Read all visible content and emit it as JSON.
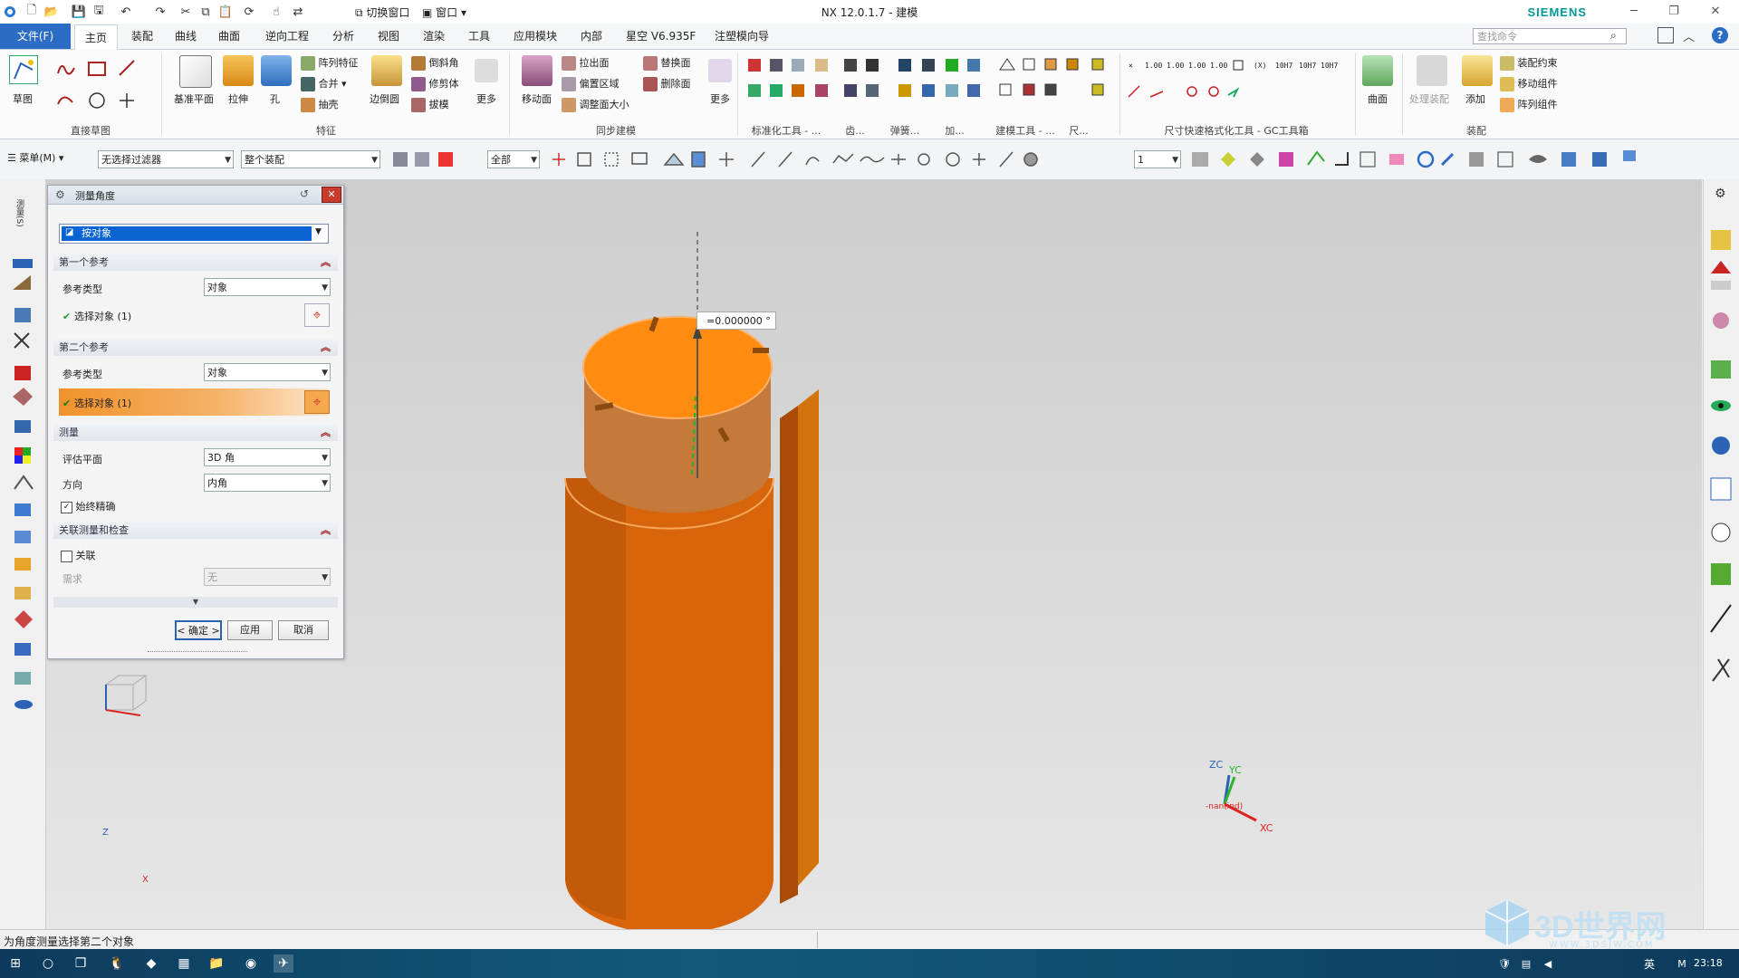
{
  "window": {
    "title": "NX 12.0.1.7 - 建模",
    "brand": "SIEMENS",
    "quick_access": [
      "切换窗口",
      "窗口"
    ]
  },
  "tabs": [
    "文件(F)",
    "主页",
    "装配",
    "曲线",
    "曲面",
    "逆向工程",
    "分析",
    "视图",
    "渲染",
    "工具",
    "应用模块",
    "内部",
    "星空 V6.935F",
    "注塑模向导"
  ],
  "search": {
    "placeholder": "查找命令"
  },
  "ribbon": {
    "groups": [
      "直接草图",
      "特征",
      "同步建模",
      "标准化工具 - ...",
      "齿...",
      "弹簧...",
      "加...",
      "建模工具 - ...",
      "尺...",
      "尺寸快速格式化工具 - GC工具箱",
      "装配"
    ],
    "sketch_label": "草图",
    "datum_label": "基准平面",
    "extrude_label": "拉伸",
    "hole_label": "孔",
    "feature_items": [
      "阵列特征",
      "合并",
      "抽壳"
    ],
    "edge_blend_label": "边倒圆",
    "edge_items": [
      "倒斜角",
      "修剪体",
      "拔模"
    ],
    "more_label": "更多",
    "move_face_label": "移动面",
    "sync_items": [
      "拉出面",
      "偏置区域",
      "调整面大小"
    ],
    "replace_items": [
      "替换面",
      "删除面"
    ],
    "more2_label": "更多",
    "surface_label": "曲面",
    "process_asm_label": "处理装配",
    "add_label": "添加",
    "asm_items": [
      "装配约束",
      "移动组件",
      "阵列组件"
    ]
  },
  "toolbar": {
    "menu_label": "菜单(M)",
    "filter_value": "无选择过滤器",
    "scope_value": "整个装配",
    "all_value": "全部",
    "layer_value": "1"
  },
  "dialog": {
    "title": "测量角度",
    "type_value": "按对象",
    "sec1": "第一个参考",
    "ref_type_label": "参考类型",
    "ref_type_value1": "对象",
    "select1": "选择对象 (1)",
    "sec2": "第二个参考",
    "ref_type_value2": "对象",
    "select2": "选择对象 (1)",
    "sec3": "测量",
    "eval_plane_label": "评估平面",
    "eval_plane_value": "3D 角",
    "direction_label": "方向",
    "direction_value": "内角",
    "always_precise": "始终精确",
    "sec4": "关联测量和检查",
    "assoc_label": "关联",
    "need_label": "需求",
    "need_value": "无",
    "ok": "< 确定 >",
    "apply": "应用",
    "cancel": "取消"
  },
  "viewport": {
    "angle_readout": "=0.000000 °",
    "triad": {
      "zc": "ZC",
      "yc": "YC",
      "xc": "XC",
      "origin": "-nan(ind)"
    },
    "csys": {
      "z": "Z",
      "x": "X"
    },
    "part_color": "#e56f0c",
    "top_face_color": "#ff8c10"
  },
  "status": {
    "prompt": "为角度测量选择第二个对象"
  },
  "watermark": {
    "title": "3D世界网",
    "url": "WWW.3DSJW.COM"
  },
  "taskbar": {
    "ime": "英",
    "clock": "23:18"
  }
}
